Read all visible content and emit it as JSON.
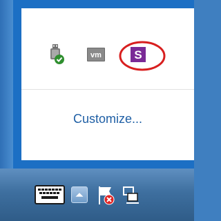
{
  "tray_overflow": {
    "icons": [
      {
        "name": "usb-safely-remove-icon",
        "label": ""
      },
      {
        "name": "vmware-tools-icon",
        "label": "vm"
      },
      {
        "name": "s-app-icon",
        "label": "S"
      }
    ],
    "highlight": {
      "target": "s-app-icon",
      "shape": "red-ellipse",
      "color": "#d81f1f"
    },
    "customize_label": "Customize..."
  },
  "taskbar": {
    "items": [
      {
        "name": "touch-keyboard-icon"
      },
      {
        "name": "show-hidden-icons-button"
      },
      {
        "name": "action-center-flag-icon"
      },
      {
        "name": "network-icon"
      }
    ]
  },
  "colors": {
    "popup_border": "#1c6fc4",
    "panel_bg": "#ffffff",
    "link": "#1f5fa5",
    "s_icon_bg": "#7a2a96",
    "taskbar": "#3e6f9f"
  }
}
